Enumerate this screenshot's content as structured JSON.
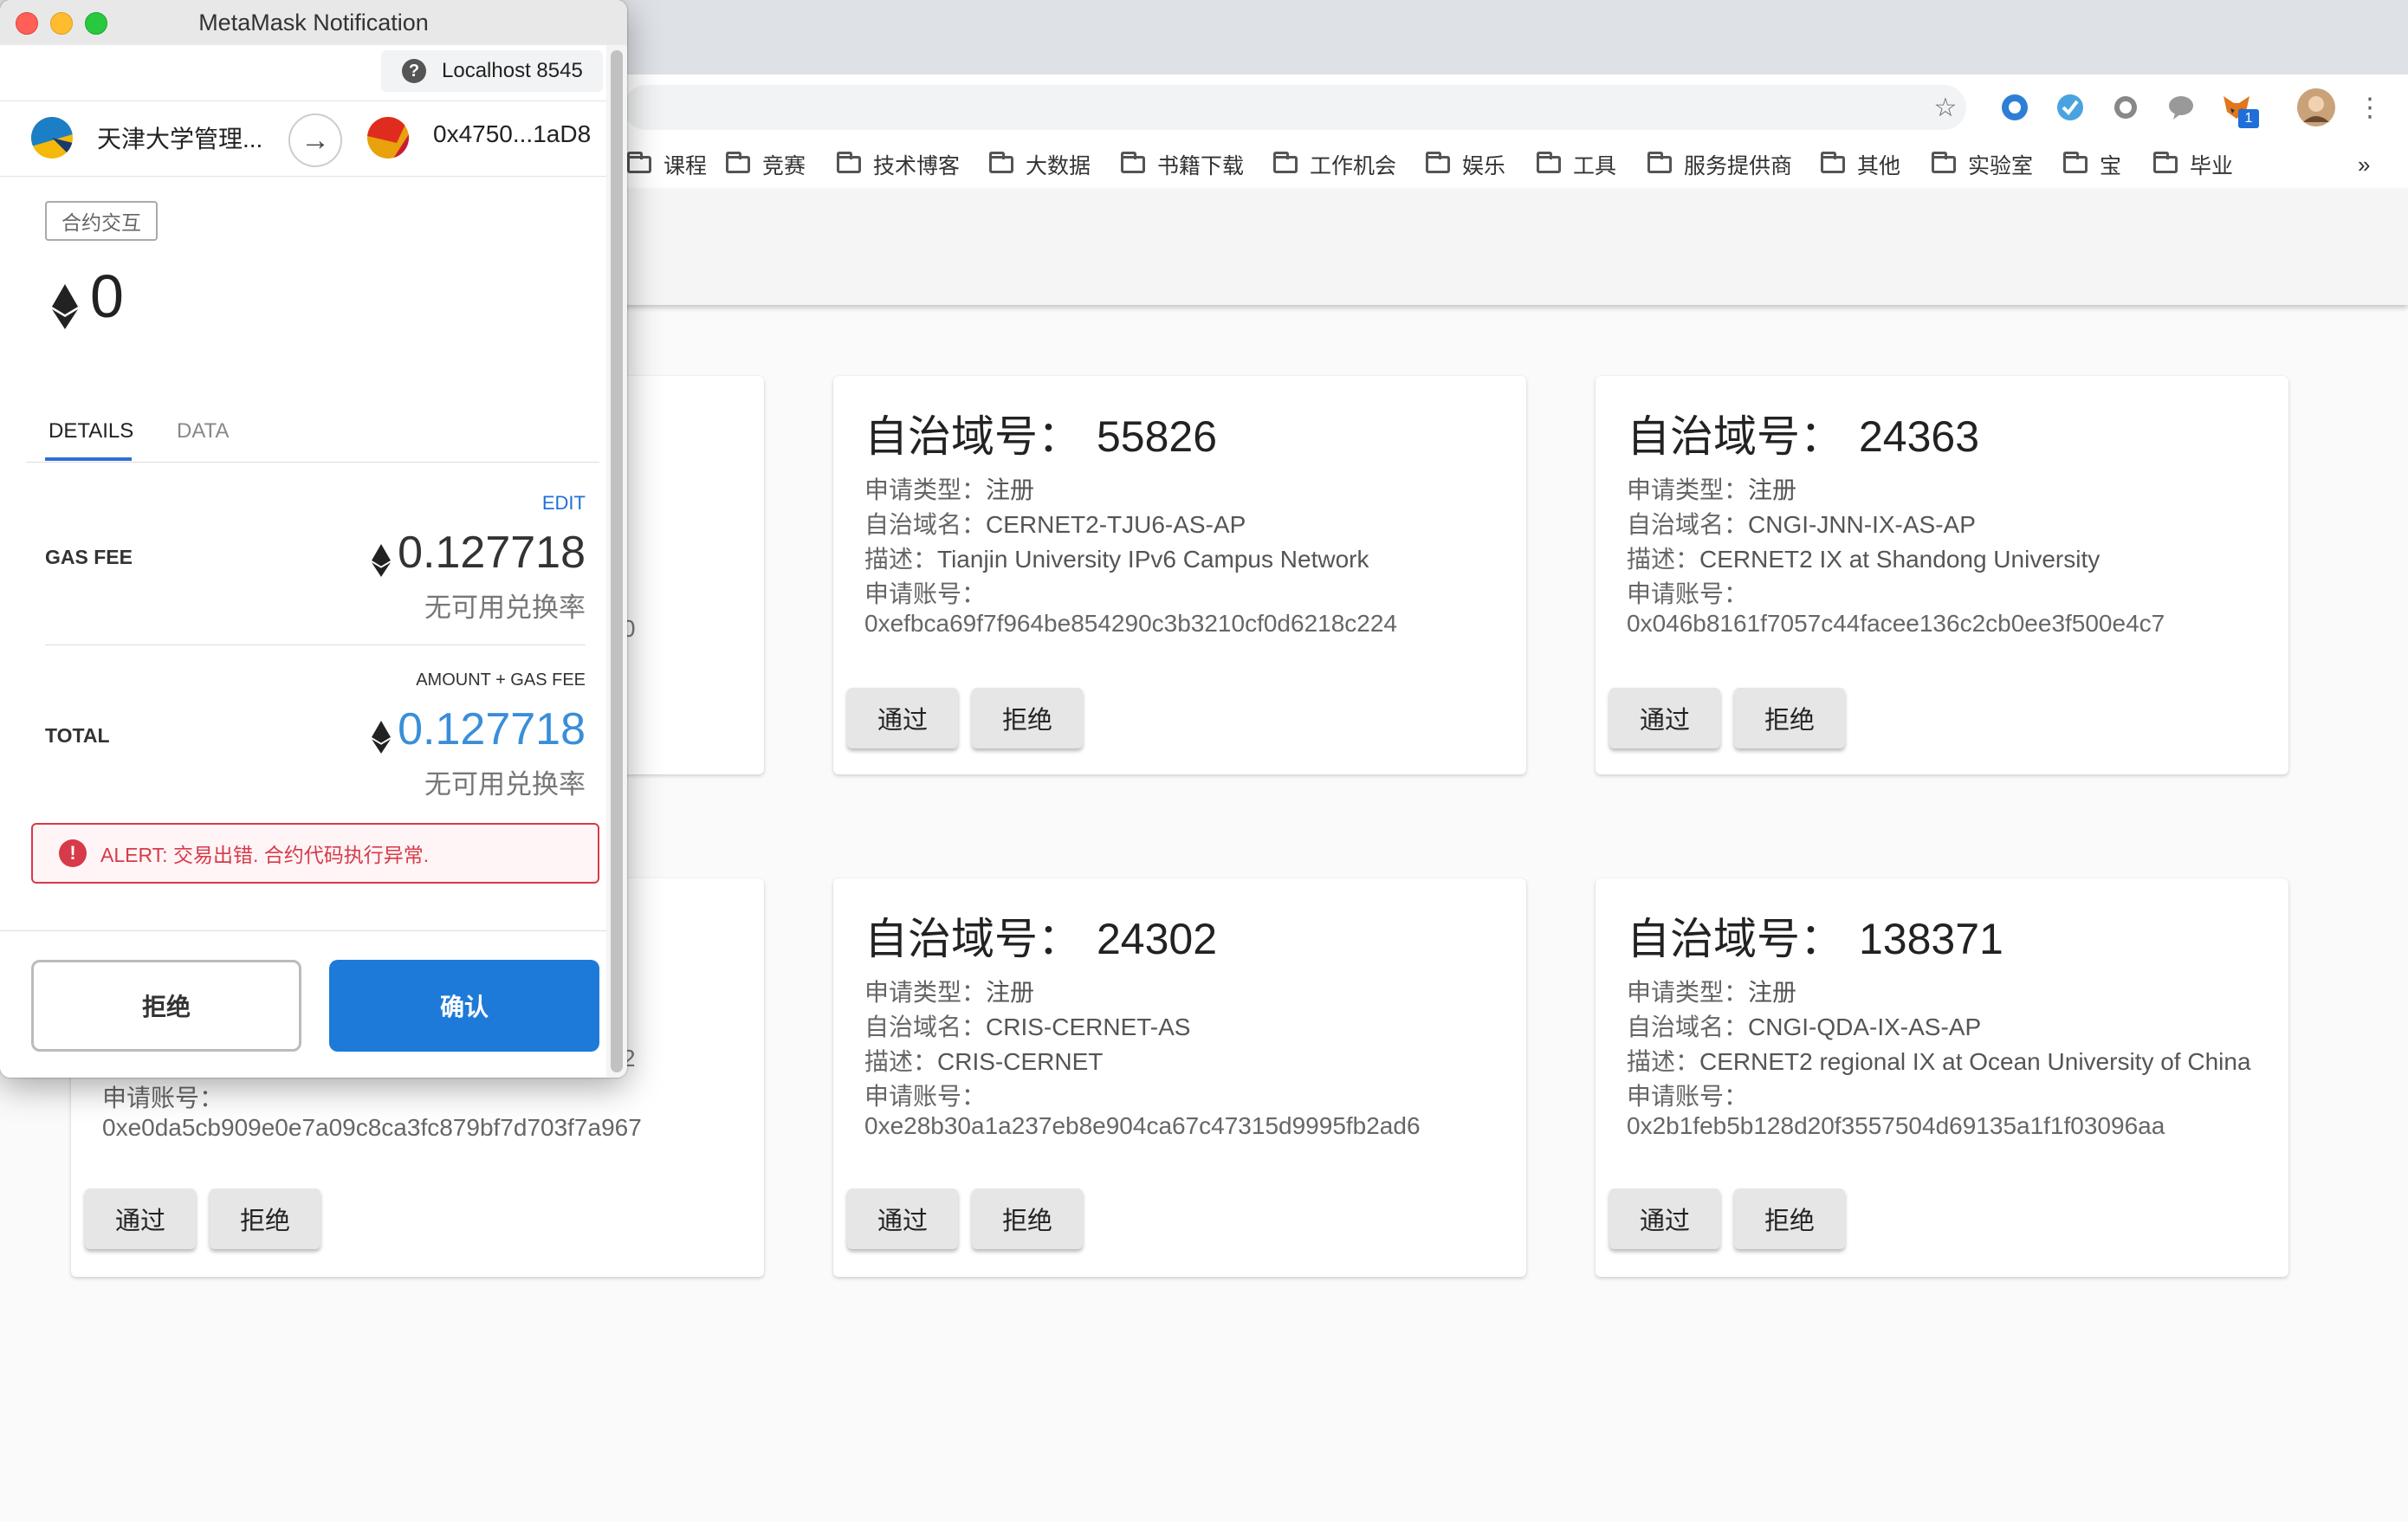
{
  "browser": {
    "bookmarks": [
      "课程",
      "竞赛",
      "技术博客",
      "大数据",
      "书籍下载",
      "工作机会",
      "娱乐",
      "工具",
      "服务提供商",
      "其他",
      "实验室",
      "宝",
      "毕业"
    ],
    "more_bookmarks": "»",
    "metamask_badge": "1"
  },
  "cards": [
    {
      "as_label": "自治域号：",
      "as_number": "55826",
      "type_label": "申请类型：",
      "type": "注册",
      "name_label": "自治域名：",
      "name": "CERNET2-TJU6-AS-AP",
      "desc_label": "描述：",
      "desc": "Tianjin University IPv6 Campus Network",
      "account_label": "申请账号：",
      "account": "0xefbca69f7f964be854290c3b3210cf0d6218c224",
      "approve": "通过",
      "reject": "拒绝"
    },
    {
      "as_label": "自治域号：",
      "as_number": "24363",
      "type_label": "申请类型：",
      "type": "注册",
      "name_label": "自治域名：",
      "name": "CNGI-JNN-IX-AS-AP",
      "desc_label": "描述：",
      "desc": "CERNET2 IX at Shandong University",
      "account_label": "申请账号：",
      "account": "0x046b8161f7057c44facee136c2cb0ee3f500e4c7",
      "approve": "通过",
      "reject": "拒绝"
    },
    {
      "account_label": "申请账号：",
      "account": "0xe0da5cb909e0e7a09c8ca3fc879bf7d703f7a967",
      "approve": "通过",
      "reject": "拒绝"
    },
    {
      "as_label": "自治域号：",
      "as_number": "24302",
      "type_label": "申请类型：",
      "type": "注册",
      "name_label": "自治域名：",
      "name": "CRIS-CERNET-AS",
      "desc_label": "描述：",
      "desc": "CRIS-CERNET",
      "account_label": "申请账号：",
      "account": "0xe28b30a1a237eb8e904ca67c47315d9995fb2ad6",
      "approve": "通过",
      "reject": "拒绝"
    },
    {
      "as_label": "自治域号：",
      "as_number": "138371",
      "type_label": "申请类型：",
      "type": "注册",
      "name_label": "自治域名：",
      "name": "CNGI-QDA-IX-AS-AP",
      "desc_label": "描述：",
      "desc": "CERNET2 regional IX at Ocean University of China",
      "account_label": "申请账号：",
      "account": "0x2b1feb5b128d20f3557504d69135a1f1f03096aa",
      "approve": "通过",
      "reject": "拒绝"
    }
  ],
  "hidden_fragments": {
    "card1_tail": "0",
    "card4_tail": "2"
  },
  "metamask": {
    "window_title": "MetaMask Notification",
    "network": "Localhost 8545",
    "from_account": "天津大学管理...",
    "to_account": "0x4750...1aD8",
    "interaction_tag": "合约交互",
    "amount": "0",
    "tabs": [
      "DETAILS",
      "DATA"
    ],
    "edit": "EDIT",
    "gas_fee_label": "GAS FEE",
    "gas_fee": "0.127718",
    "gas_fee_rate": "无可用兑换率",
    "amount_gas_label": "AMOUNT + GAS FEE",
    "total_label": "TOTAL",
    "total": "0.127718",
    "total_rate": "无可用兑换率",
    "alert": "ALERT: 交易出错. 合约代码执行异常.",
    "reject_button": "拒绝",
    "confirm_button": "确认",
    "colors": {
      "accent": "#1e7ad9",
      "total_value": "#3a8ed8",
      "alert": "#d73a49"
    }
  }
}
